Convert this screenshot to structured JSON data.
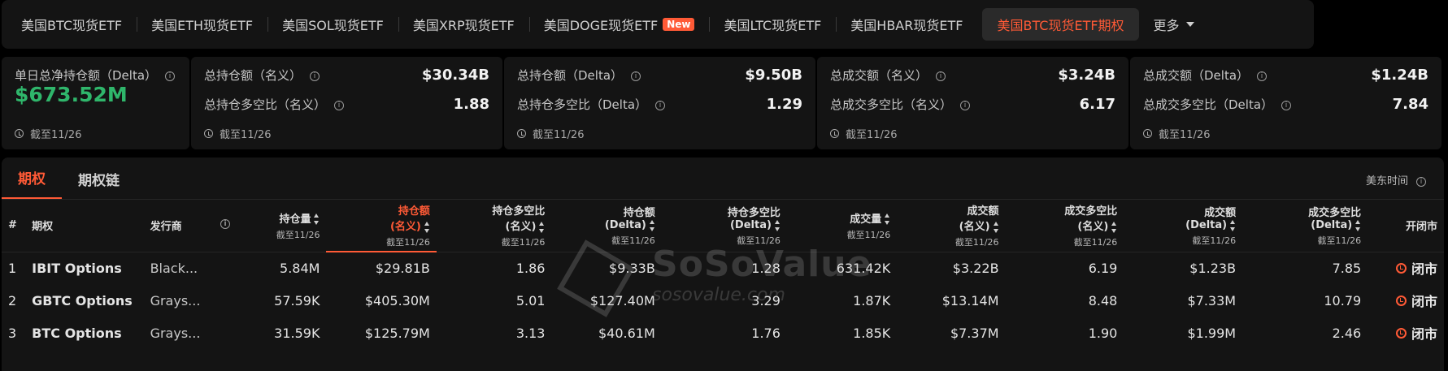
{
  "tabs": [
    {
      "label": "美国BTC现货ETF"
    },
    {
      "label": "美国ETH现货ETF"
    },
    {
      "label": "美国SOL现货ETF"
    },
    {
      "label": "美国XRP现货ETF"
    },
    {
      "label": "美国DOGE现货ETF",
      "badge": "New"
    },
    {
      "label": "美国LTC现货ETF"
    },
    {
      "label": "美国HBAR现货ETF"
    },
    {
      "label": "美国BTC现货ETF期权",
      "active": true
    },
    {
      "label": "更多"
    }
  ],
  "stats": {
    "daily_net": {
      "label": "单日总净持仓额（Delta）",
      "value": "$673.52M",
      "asof": "截至11/26"
    },
    "oi_card": {
      "label_a": "总持仓额（名义）",
      "value_a": "$30.34B",
      "label_b": "总持仓多空比（名义）",
      "value_b": "1.88",
      "asof": "截至11/26"
    },
    "oi_delta_card": {
      "label_a": "总持仓额（Delta）",
      "value_a": "$9.50B",
      "label_b": "总持仓多空比（Delta）",
      "value_b": "1.29",
      "asof": "截至11/26"
    },
    "vol_card": {
      "label_a": "总成交额（名义）",
      "value_a": "$3.24B",
      "label_b": "总成交多空比（名义）",
      "value_b": "6.17",
      "asof": "截至11/26"
    },
    "vol_delta_card": {
      "label_a": "总成交额（Delta）",
      "value_a": "$1.24B",
      "label_b": "总成交多空比（Delta）",
      "value_b": "7.84",
      "asof": "截至11/26"
    }
  },
  "panel": {
    "tabs": [
      "期权",
      "期权链"
    ],
    "timezone": "美东时间"
  },
  "table": {
    "headers": {
      "index": "#",
      "option": "期权",
      "issuer": "发行商",
      "oi_qty": {
        "title": "持仓量",
        "sub": "截至11/26"
      },
      "oi_notional": {
        "title": "持仓额",
        "title2": "(名义)",
        "sub": "截至11/26"
      },
      "oi_ratio_notional": {
        "title": "持仓多空比",
        "title2": "(名义)",
        "sub": "截至11/26"
      },
      "oi_delta": {
        "title": "持仓额",
        "title2": "(Delta)",
        "sub": "截至11/26"
      },
      "oi_ratio_delta": {
        "title": "持仓多空比",
        "title2": "(Delta)",
        "sub": "截至11/26"
      },
      "volume": {
        "title": "成交量",
        "sub": "截至11/26"
      },
      "turnover_notional": {
        "title": "成交额",
        "title2": "(名义)",
        "sub": "截至11/26"
      },
      "vol_ratio_notional": {
        "title": "成交多空比",
        "title2": "(名义)",
        "sub": "截至11/26"
      },
      "turnover_delta": {
        "title": "成交额",
        "title2": "(Delta)",
        "sub": "截至11/26"
      },
      "vol_ratio_delta": {
        "title": "成交多空比",
        "title2": "(Delta)",
        "sub": "截至11/26"
      },
      "market": "开闭市"
    },
    "rows": [
      {
        "idx": "1",
        "name": "IBIT Options",
        "issuer": "Black...",
        "oi_qty": "5.84M",
        "oi_notional": "$29.81B",
        "oi_ratio_notional": "1.86",
        "oi_delta": "$9.33B",
        "oi_ratio_delta": "1.28",
        "volume": "631.42K",
        "turnover_notional": "$3.22B",
        "vol_ratio_notional": "6.19",
        "turnover_delta": "$1.23B",
        "vol_ratio_delta": "7.85",
        "status": "闭市"
      },
      {
        "idx": "2",
        "name": "GBTC Options",
        "issuer": "Grays...",
        "oi_qty": "57.59K",
        "oi_notional": "$405.30M",
        "oi_ratio_notional": "5.01",
        "oi_delta": "$127.40M",
        "oi_ratio_delta": "3.29",
        "volume": "1.87K",
        "turnover_notional": "$13.14M",
        "vol_ratio_notional": "8.48",
        "turnover_delta": "$7.33M",
        "vol_ratio_delta": "10.79",
        "status": "闭市"
      },
      {
        "idx": "3",
        "name": "BTC Options",
        "issuer": "Grays...",
        "oi_qty": "31.59K",
        "oi_notional": "$125.79M",
        "oi_ratio_notional": "3.13",
        "oi_delta": "$40.61M",
        "oi_ratio_delta": "1.76",
        "volume": "1.85K",
        "turnover_notional": "$7.37M",
        "vol_ratio_notional": "1.90",
        "turnover_delta": "$1.99M",
        "vol_ratio_delta": "2.46",
        "status": "闭市"
      }
    ]
  },
  "watermark": {
    "brand": "SoSoValue",
    "domain": "sosovalue.com"
  },
  "colors": {
    "accent": "#ff5a36",
    "positive": "#2fb66b",
    "panel": "#141414"
  }
}
